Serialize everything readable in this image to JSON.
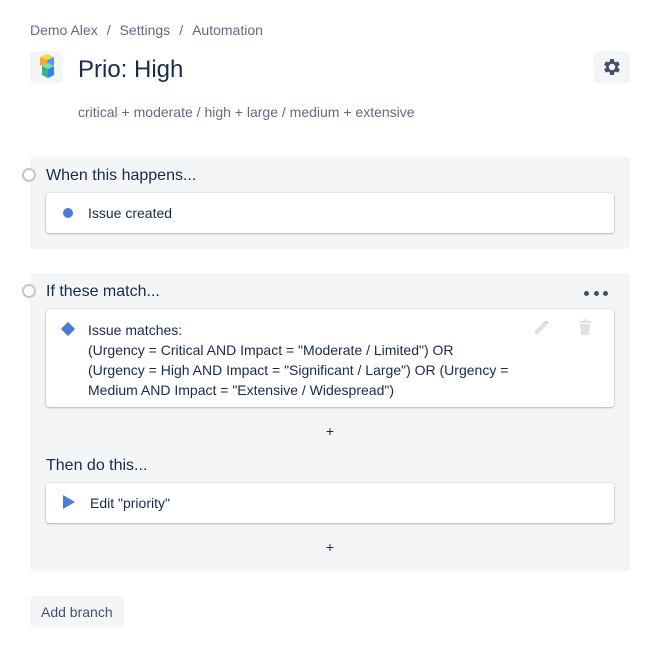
{
  "breadcrumb": {
    "items": [
      "Demo Alex",
      "Settings",
      "Automation"
    ],
    "separator": "/"
  },
  "rule": {
    "title": "Prio: High",
    "description": "critical + moderate / high + large / medium + extensive",
    "icon": "rule-cube-icon"
  },
  "trigger": {
    "heading": "When this happens...",
    "card_label": "Issue created",
    "icon": "dot-icon"
  },
  "condition": {
    "heading": "If these match...",
    "lines": [
      "Issue matches:",
      "(Urgency = Critical AND Impact = \"Moderate / Limited\") OR",
      "(Urgency = High AND Impact = \"Significant / Large\") OR (Urgency =",
      "Medium AND Impact = \"Extensive / Widespread\")"
    ],
    "icon": "diamond-icon"
  },
  "action": {
    "heading": "Then do this...",
    "card_label": "Edit \"priority\"",
    "icon": "play-icon"
  },
  "add_symbol": "+",
  "add_branch_label": "Add branch",
  "colors": {
    "accent": "#4a7dd4",
    "panel_bg": "#f4f5f7",
    "text": "#172b4d",
    "muted": "#5e6c84"
  }
}
